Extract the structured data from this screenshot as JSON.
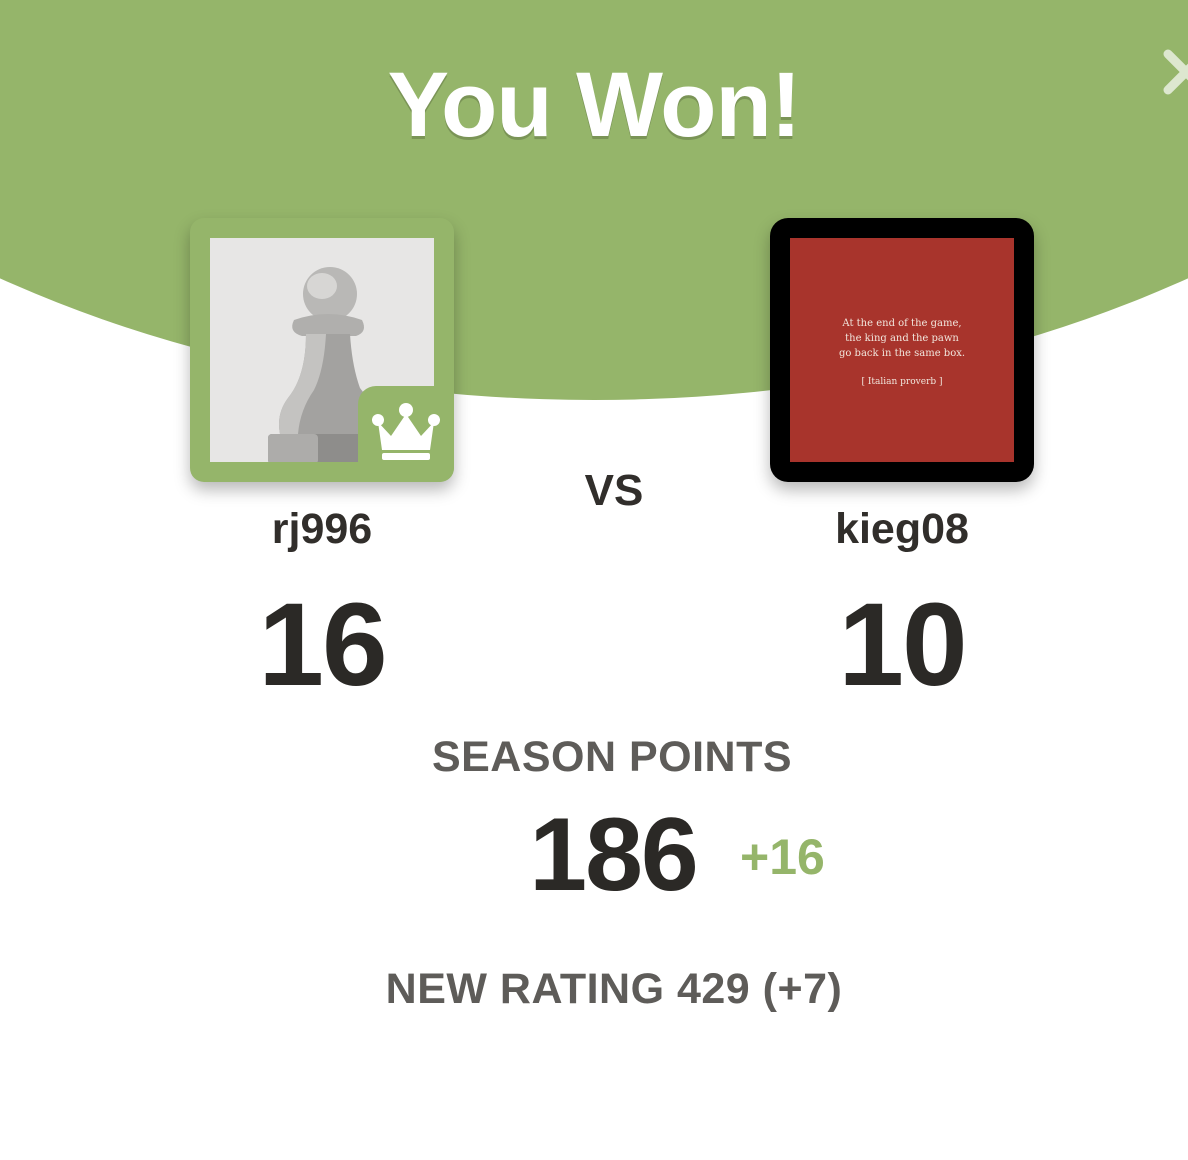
{
  "colors": {
    "accent": "#95b56a",
    "opponent_avatar_bg": "#a8342c",
    "text_dark": "#312e2b",
    "text_muted": "#5e5c59"
  },
  "header": {
    "title": "You Won!",
    "close_icon": "close-icon"
  },
  "player": {
    "username": "rj996",
    "score": "16",
    "avatar_icon": "pawn-icon",
    "badge_icon": "crown-icon"
  },
  "vs_label": "VS",
  "opponent": {
    "username": "kieg08",
    "score": "10",
    "avatar_quote": {
      "line1": "At the end of the game,",
      "line2": "the king and the pawn",
      "line3": "go back in the same box.",
      "source": "[ Italian proverb ]"
    }
  },
  "season": {
    "label": "SEASON POINTS",
    "points": "186",
    "delta": "+16"
  },
  "rating": {
    "text": "NEW RATING 429 (+7)"
  }
}
